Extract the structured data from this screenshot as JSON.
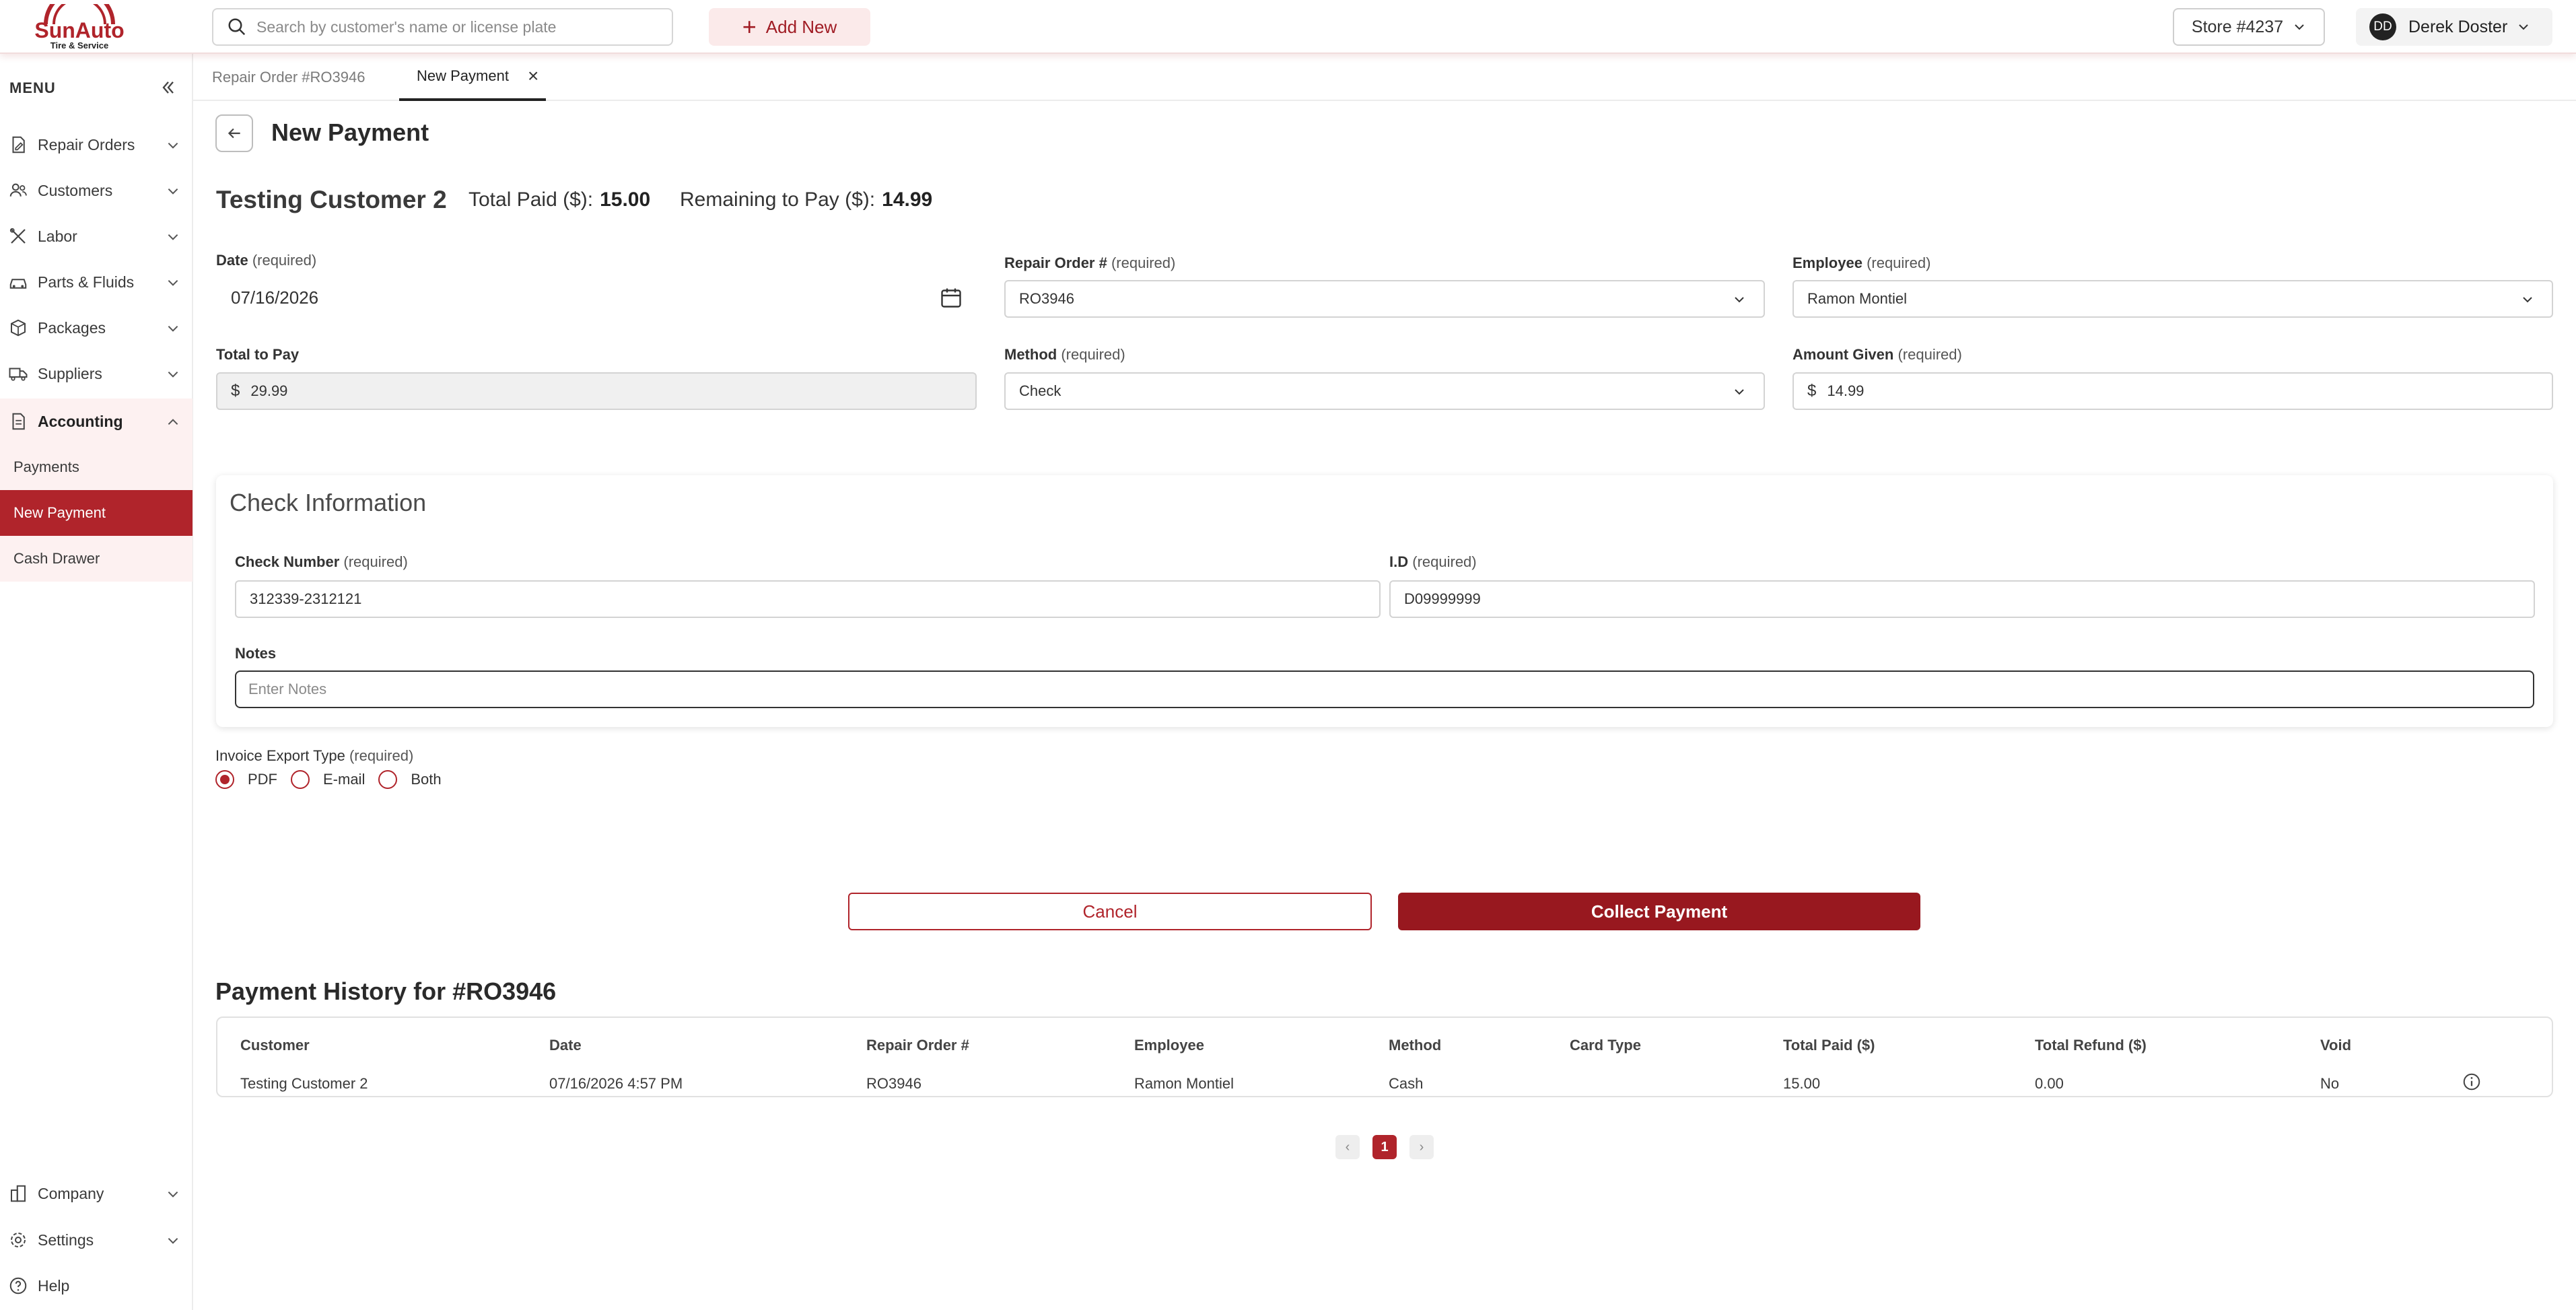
{
  "brand": {
    "name": "SunAuto",
    "tagline": "Tire & Service",
    "accent": "#b0242b"
  },
  "topbar": {
    "search_placeholder": "Search by customer's name or license plate",
    "add_new_label": "Add New",
    "store_label": "Store #4237",
    "user_initials": "DD",
    "user_name": "Derek Doster"
  },
  "sidebar": {
    "menu_label": "MENU",
    "items": [
      {
        "label": "Repair Orders",
        "icon": "file-edit-icon"
      },
      {
        "label": "Customers",
        "icon": "users-icon"
      },
      {
        "label": "Labor",
        "icon": "tools-icon"
      },
      {
        "label": "Parts & Fluids",
        "icon": "car-icon"
      },
      {
        "label": "Packages",
        "icon": "box-icon"
      },
      {
        "label": "Suppliers",
        "icon": "truck-icon"
      },
      {
        "label": "Accounting",
        "icon": "invoice-icon"
      }
    ],
    "accounting_sub": [
      "Payments",
      "New Payment",
      "Cash Drawer"
    ],
    "bottom_items": [
      {
        "label": "Company",
        "icon": "building-icon"
      },
      {
        "label": "Settings",
        "icon": "gear-icon"
      },
      {
        "label": "Help",
        "icon": "help-icon"
      }
    ]
  },
  "tabs": [
    {
      "label": "Repair Order #RO3946",
      "active": false
    },
    {
      "label": "New Payment",
      "active": true
    }
  ],
  "page": {
    "title": "New Payment",
    "customer_name": "Testing Customer 2",
    "total_paid_label": "Total Paid ($):",
    "total_paid_value": "15.00",
    "remaining_label": "Remaining to Pay ($):",
    "remaining_value": "14.99"
  },
  "form": {
    "required_suffix": "(required)",
    "date_label": "Date",
    "date_value": "07/16/2026",
    "repair_order_label": "Repair Order #",
    "repair_order_value": "RO3946",
    "employee_label": "Employee",
    "employee_value": "Ramon Montiel",
    "total_to_pay_label": "Total to Pay",
    "currency": "$",
    "total_to_pay_value": "29.99",
    "method_label": "Method",
    "method_value": "Check",
    "amount_given_label": "Amount Given",
    "amount_given_value": "14.99"
  },
  "check_info": {
    "title": "Check Information",
    "check_number_label": "Check Number",
    "check_number_value": "312339-2312121",
    "id_label": "I.D",
    "id_value": "D09999999",
    "notes_label": "Notes",
    "notes_placeholder": "Enter Notes"
  },
  "export": {
    "label": "Invoice Export Type",
    "options": [
      "PDF",
      "E-mail",
      "Both"
    ],
    "selected": "PDF"
  },
  "actions": {
    "cancel_label": "Cancel",
    "collect_label": "Collect Payment"
  },
  "history": {
    "title": "Payment History for #RO3946",
    "columns": [
      "Customer",
      "Date",
      "Repair Order #",
      "Employee",
      "Method",
      "Card Type",
      "Total Paid ($)",
      "Total Refund ($)",
      "Void"
    ],
    "rows": [
      [
        "Testing Customer 2",
        "07/16/2026 4:57 PM",
        "RO3946",
        "Ramon Montiel",
        "Cash",
        "",
        "15.00",
        "0.00",
        "No"
      ]
    ]
  },
  "pagination": {
    "prev": "‹",
    "current": "1",
    "next": "›"
  }
}
